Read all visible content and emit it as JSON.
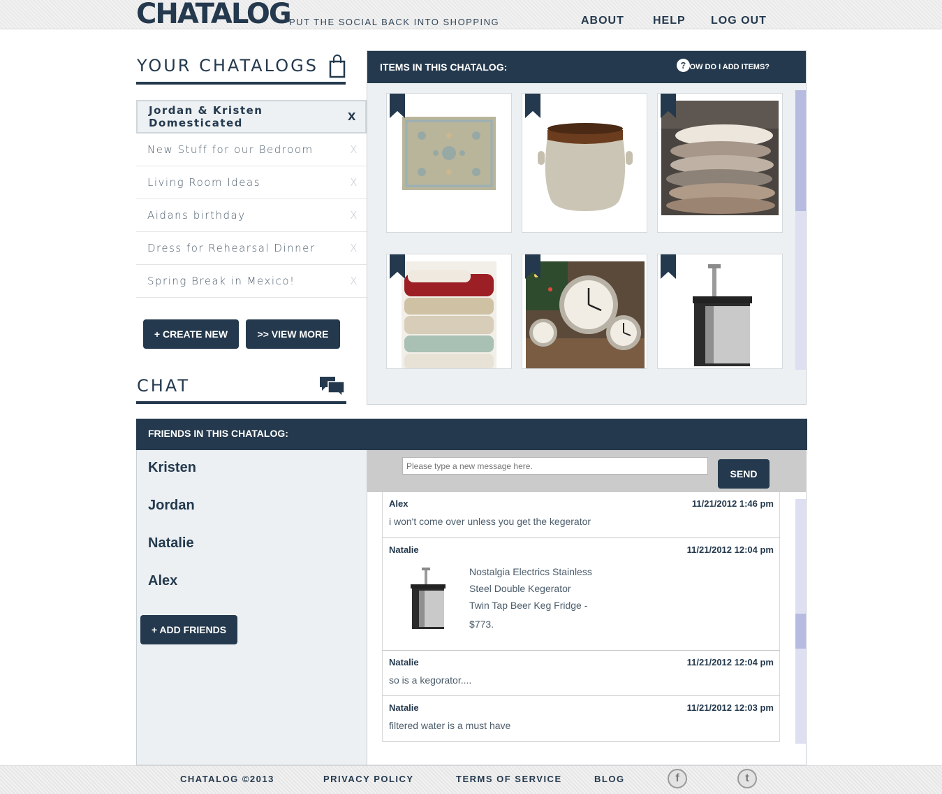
{
  "header": {
    "logo": "CHATALOG",
    "tagline": "PUT THE SOCIAL BACK INTO SHOPPING",
    "nav": [
      "ABOUT",
      "HELP",
      "LOG OUT"
    ]
  },
  "chatalogs": {
    "heading": "YOUR CHATALOGS",
    "items": [
      {
        "label": "Jordan & Kristen Domesticated",
        "remove": "X"
      },
      {
        "label": "New Stuff for our Bedroom",
        "remove": "X"
      },
      {
        "label": "Living Room Ideas",
        "remove": "X"
      },
      {
        "label": "Aidans birthday",
        "remove": "X"
      },
      {
        "label": "Dress for Rehearsal Dinner",
        "remove": "X"
      },
      {
        "label": "Spring Break in Mexico!",
        "remove": "X"
      }
    ],
    "create_label": "+ CREATE NEW",
    "more_label": ">> VIEW MORE"
  },
  "items_panel": {
    "title": "ITEMS IN THIS CHATALOG:",
    "help_icon": "?",
    "help_label": "HOW DO I ADD ITEMS?",
    "items": [
      {
        "icon": "rug"
      },
      {
        "icon": "crock-pot"
      },
      {
        "icon": "fur-throws"
      },
      {
        "icon": "knit-blankets"
      },
      {
        "icon": "alarm-clocks"
      },
      {
        "icon": "kegerator"
      }
    ]
  },
  "chat": {
    "heading": "CHAT",
    "friends_title": "FRIENDS IN THIS CHATALOG:",
    "friends": [
      "Kristen",
      "Jordan",
      "Natalie",
      "Alex"
    ],
    "add_friends_label": "+ ADD FRIENDS",
    "input_placeholder": "Please type a new message here.",
    "send_label": "SEND",
    "messages": [
      {
        "user": "Alex",
        "time": "11/21/2012 1:46 pm",
        "text": "i won't come over unless you get the kegerator"
      },
      {
        "user": "Natalie",
        "time": "11/21/2012 12:04 pm",
        "product": [
          "Nostalgia Electrics Stainless",
          "Steel Double Kegerator",
          "Twin Tap Beer Keg Fridge -",
          "$773."
        ]
      },
      {
        "user": "Natalie",
        "time": "11/21/2012 12:04 pm",
        "text": "so is a kegorator...."
      },
      {
        "user": "Natalie",
        "time": "11/21/2012 12:03 pm",
        "text": "filtered water is a must have"
      }
    ]
  },
  "footer": {
    "copyright": "CHATALOG ©2013",
    "links": [
      "PRIVACY POLICY",
      "TERMS OF SERVICE",
      "BLOG"
    ],
    "facebook": "f",
    "twitter": "t"
  },
  "colors": {
    "navy": "#24394d",
    "panel": "#ecf0f3",
    "scroll": "#b8bbe0"
  }
}
